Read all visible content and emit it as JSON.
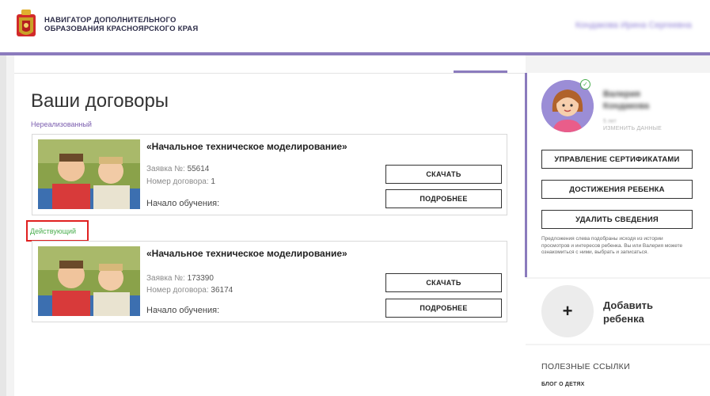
{
  "header": {
    "title_line1": "НАВИГАТОР ДОПОЛНИТЕЛЬНОГО",
    "title_line2": "ОБРАЗОВАНИЯ КРАСНОЯРСКОГО КРАЯ",
    "user_link": "Кондакова Ирина Сергеевна"
  },
  "main": {
    "title": "Ваши договоры",
    "groups": [
      {
        "status": "Нереализованный",
        "contract": {
          "title": "«Начальное техническое моделирование»",
          "request_label": "Заявка №:",
          "request_value": "55614",
          "contract_label": "Номер договора:",
          "contract_value": "1",
          "start_label": "Начало обучения:",
          "download_label": "СКАЧАТЬ",
          "details_label": "ПОДРОБНЕЕ"
        }
      },
      {
        "status": "Действующий",
        "contract": {
          "title": "«Начальное техническое моделирование»",
          "request_label": "Заявка №:",
          "request_value": "173390",
          "contract_label": "Номер договора:",
          "contract_value": "36174",
          "start_label": "Начало обучения:",
          "download_label": "СКАЧАТЬ",
          "details_label": "ПОДРОБНЕЕ"
        }
      }
    ]
  },
  "sidebar": {
    "user_name_line1": "Валерия",
    "user_name_line2": "Кондакова",
    "user_meta": "5 лет",
    "edit_link": "ИЗМЕНИТЬ ДАННЫЕ",
    "buttons": {
      "certificates": "УПРАВЛЕНИЕ СЕРТИФИКАТАМИ",
      "achievements": "ДОСТИЖЕНИЯ РЕБЕНКА",
      "delete": "УДАЛИТЬ СВЕДЕНИЯ"
    },
    "note": "Предложения слева подобраны исходя из истории просмотров и интересов ребенка. Вы или Валерия можете ознакомиться с ними, выбрать и записаться.",
    "add_child_icon": "+",
    "add_child_label": "Добавить ребенка",
    "links_title": "ПОЛЕЗНЫЕ ССЫЛКИ",
    "links": [
      "БЛОГ О ДЕТЯХ"
    ]
  },
  "colors": {
    "accent": "#8b7bbd",
    "status_unrealized": "#7a5cae",
    "status_active": "#4caf50",
    "highlight_box": "#e02020"
  }
}
